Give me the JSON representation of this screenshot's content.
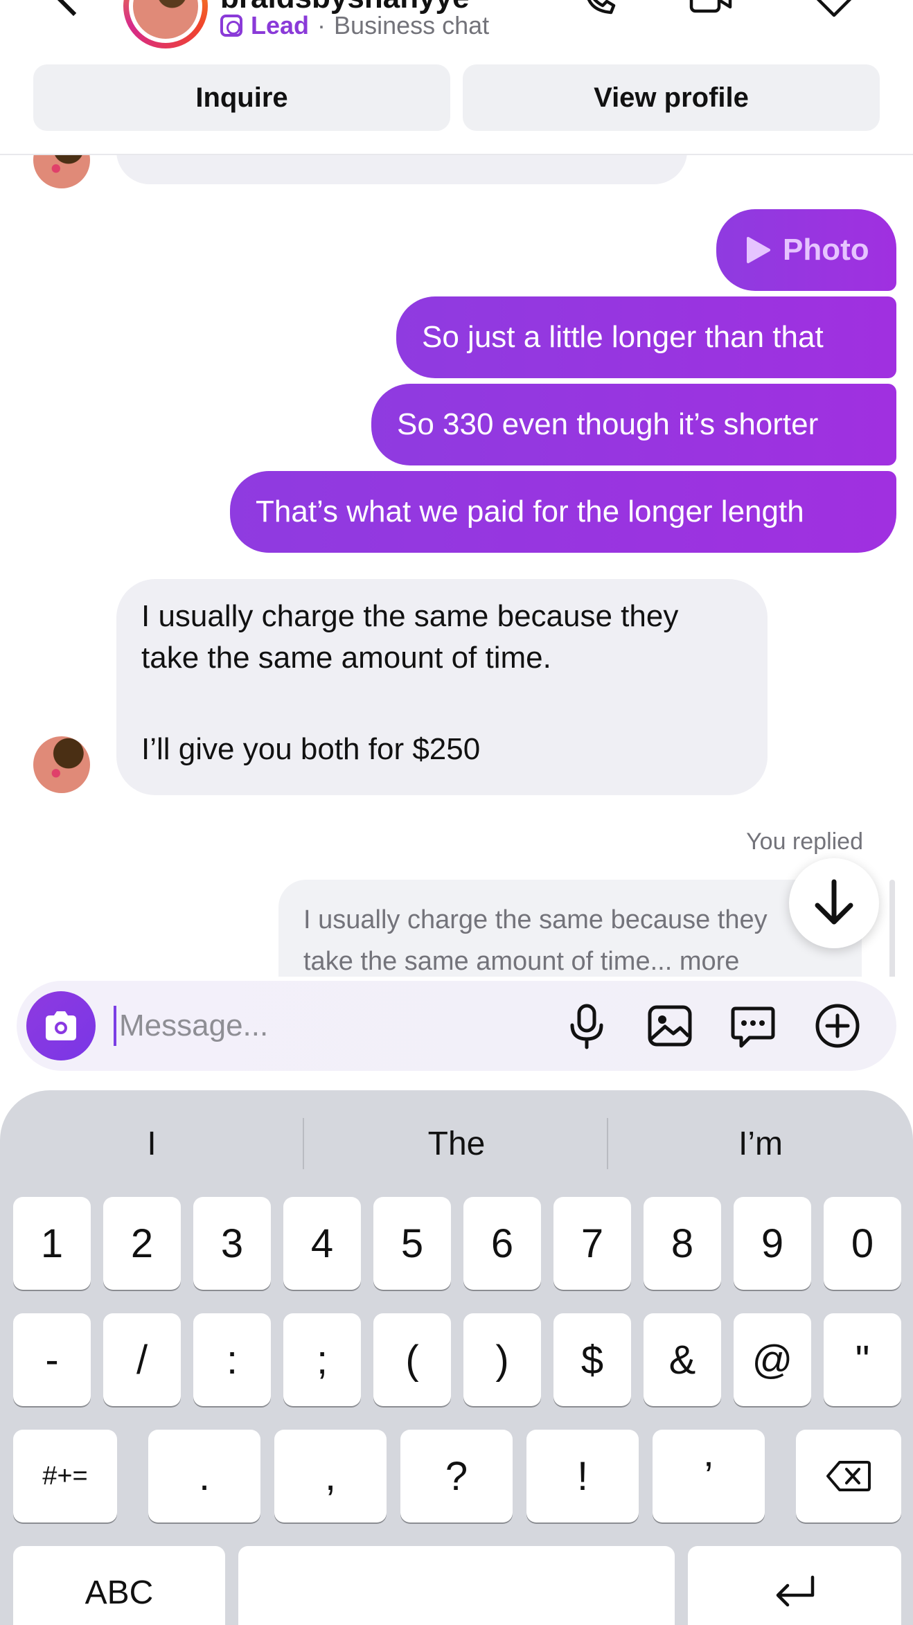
{
  "header": {
    "handle": "braidsbyshanyye",
    "lead_label": "Lead",
    "separator": "·",
    "chat_type": "Business chat",
    "inquire_label": "Inquire",
    "view_profile_label": "View profile",
    "icons": [
      "back-icon",
      "phone-icon",
      "video-icon",
      "tag-icon"
    ]
  },
  "messages": [
    {
      "id": "photo",
      "direction": "outgoing",
      "label": "Photo",
      "icon": "play-icon"
    },
    {
      "id": "m1",
      "direction": "outgoing",
      "text": "So just a little longer than that"
    },
    {
      "id": "m2",
      "direction": "outgoing",
      "text": "So 330 even though it’s shorter"
    },
    {
      "id": "m3",
      "direction": "outgoing",
      "text": "That’s what we paid for the longer length"
    },
    {
      "id": "m4",
      "direction": "incoming",
      "lines": [
        "I usually charge the same because they",
        "take the same amount of time.",
        "",
        "I’ll give you both for $250"
      ]
    }
  ],
  "reply": {
    "label": "You replied",
    "lines": [
      "I usually charge the same because they",
      "take the same amount of time... more"
    ]
  },
  "composer": {
    "placeholder": "Message...",
    "icons": [
      "camera-icon",
      "microphone-icon",
      "gallery-icon",
      "sticker-icon",
      "plus-icon"
    ]
  },
  "keyboard": {
    "suggestions": [
      "I",
      "The",
      "I’m"
    ],
    "row1": [
      "1",
      "2",
      "3",
      "4",
      "5",
      "6",
      "7",
      "8",
      "9",
      "0"
    ],
    "row2": [
      "-",
      "/",
      ":",
      ";",
      "(",
      ")",
      "$",
      "&",
      "@",
      "\""
    ],
    "row3_left": "#+=",
    "row3": [
      ".",
      ",",
      "?",
      "!",
      "’"
    ],
    "row4_left": "ABC",
    "icons": [
      "backspace-icon",
      "return-icon"
    ]
  },
  "colors": {
    "accent": "#8f3be0",
    "incoming_bubble": "#efeff4",
    "keyboard_bg": "#d5d7dd"
  }
}
